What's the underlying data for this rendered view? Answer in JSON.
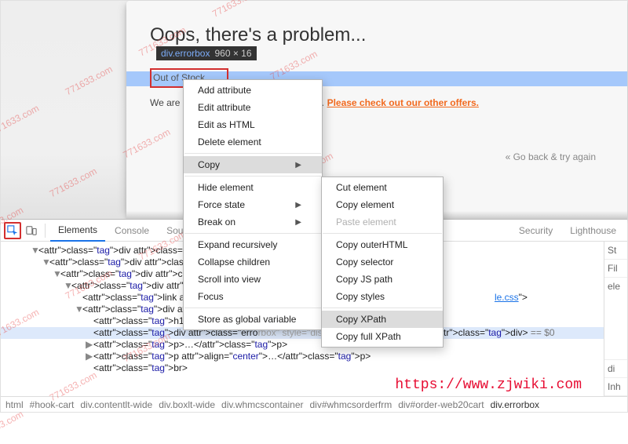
{
  "watermark_text": "771633.com",
  "overlay_url": "https://www.zjwiki.com",
  "page": {
    "title": "Oops, there's a problem...",
    "tooltip_selector": "div.errorbox",
    "tooltip_dims": "960 × 16",
    "error_text": "Out of Stock",
    "body_prefix": "We are ",
    "body_link": "Please check out our other offers.",
    "go_back": "« Go back & try again"
  },
  "devtools": {
    "tabs": [
      "Elements",
      "Console",
      "Sourc",
      "Security",
      "Lighthouse"
    ],
    "active_tab": 0,
    "styles_pane": [
      "St",
      "Fil",
      "ele",
      "di",
      "Inh"
    ],
    "breadcrumb": [
      "html",
      "#hook-cart",
      "div.contentlt-wide",
      "div.boxlt-wide",
      "div.whmcscontainer",
      "div#whmcsorderfrm",
      "div#order-web20cart",
      "div.errorbox"
    ],
    "dom_lines": [
      {
        "indent": 0,
        "arrow": "▼",
        "html": "<div class=\"contentlt-wide\">"
      },
      {
        "indent": 1,
        "arrow": "▼",
        "html": "<div class=\"boxlt-wide\">"
      },
      {
        "indent": 2,
        "arrow": "▼",
        "html": "<div class=\"whmcsconta"
      },
      {
        "indent": 3,
        "arrow": "▼",
        "html": "<div id=\"whmcsorderfrm"
      },
      {
        "indent": 4,
        "arrow": "",
        "html": "<link rel=\"styleshe",
        "link": "le.css",
        "tail": "\">"
      },
      {
        "indent": 4,
        "arrow": "▼",
        "html": "<div id=\"order-web2"
      },
      {
        "indent": 5,
        "arrow": "",
        "html": "<h1>Oops, there's"
      },
      {
        "indent": 5,
        "arrow": "",
        "html_pre": "<div class=\"erro",
        "html_mid": "ut of Stock",
        "html_post": "</div>",
        "eq": " == $0",
        "hl": true,
        "hidden_mid": "rbox\" style=\"display:block;\">O"
      },
      {
        "indent": 5,
        "arrow": "▶",
        "html": "<p>…</p>"
      },
      {
        "indent": 5,
        "arrow": "▶",
        "html": "<p align=\"center\">…</p>"
      },
      {
        "indent": 5,
        "arrow": "",
        "html": "<br>"
      }
    ]
  },
  "context_menu_1": {
    "groups": [
      [
        {
          "label": "Add attribute"
        },
        {
          "label": "Edit attribute"
        },
        {
          "label": "Edit as HTML"
        },
        {
          "label": "Delete element"
        }
      ],
      [
        {
          "label": "Copy",
          "submenu": true,
          "highlighted": true
        }
      ],
      [
        {
          "label": "Hide element"
        },
        {
          "label": "Force state",
          "submenu": true
        },
        {
          "label": "Break on",
          "submenu": true
        }
      ],
      [
        {
          "label": "Expand recursively"
        },
        {
          "label": "Collapse children"
        },
        {
          "label": "Scroll into view"
        },
        {
          "label": "Focus"
        }
      ],
      [
        {
          "label": "Store as global variable"
        }
      ]
    ]
  },
  "context_menu_2": {
    "groups": [
      [
        {
          "label": "Cut element"
        },
        {
          "label": "Copy element"
        },
        {
          "label": "Paste element",
          "disabled": true
        }
      ],
      [
        {
          "label": "Copy outerHTML"
        },
        {
          "label": "Copy selector"
        },
        {
          "label": "Copy JS path"
        },
        {
          "label": "Copy styles"
        }
      ],
      [
        {
          "label": "Copy XPath",
          "highlighted": true
        },
        {
          "label": "Copy full XPath"
        }
      ]
    ]
  }
}
